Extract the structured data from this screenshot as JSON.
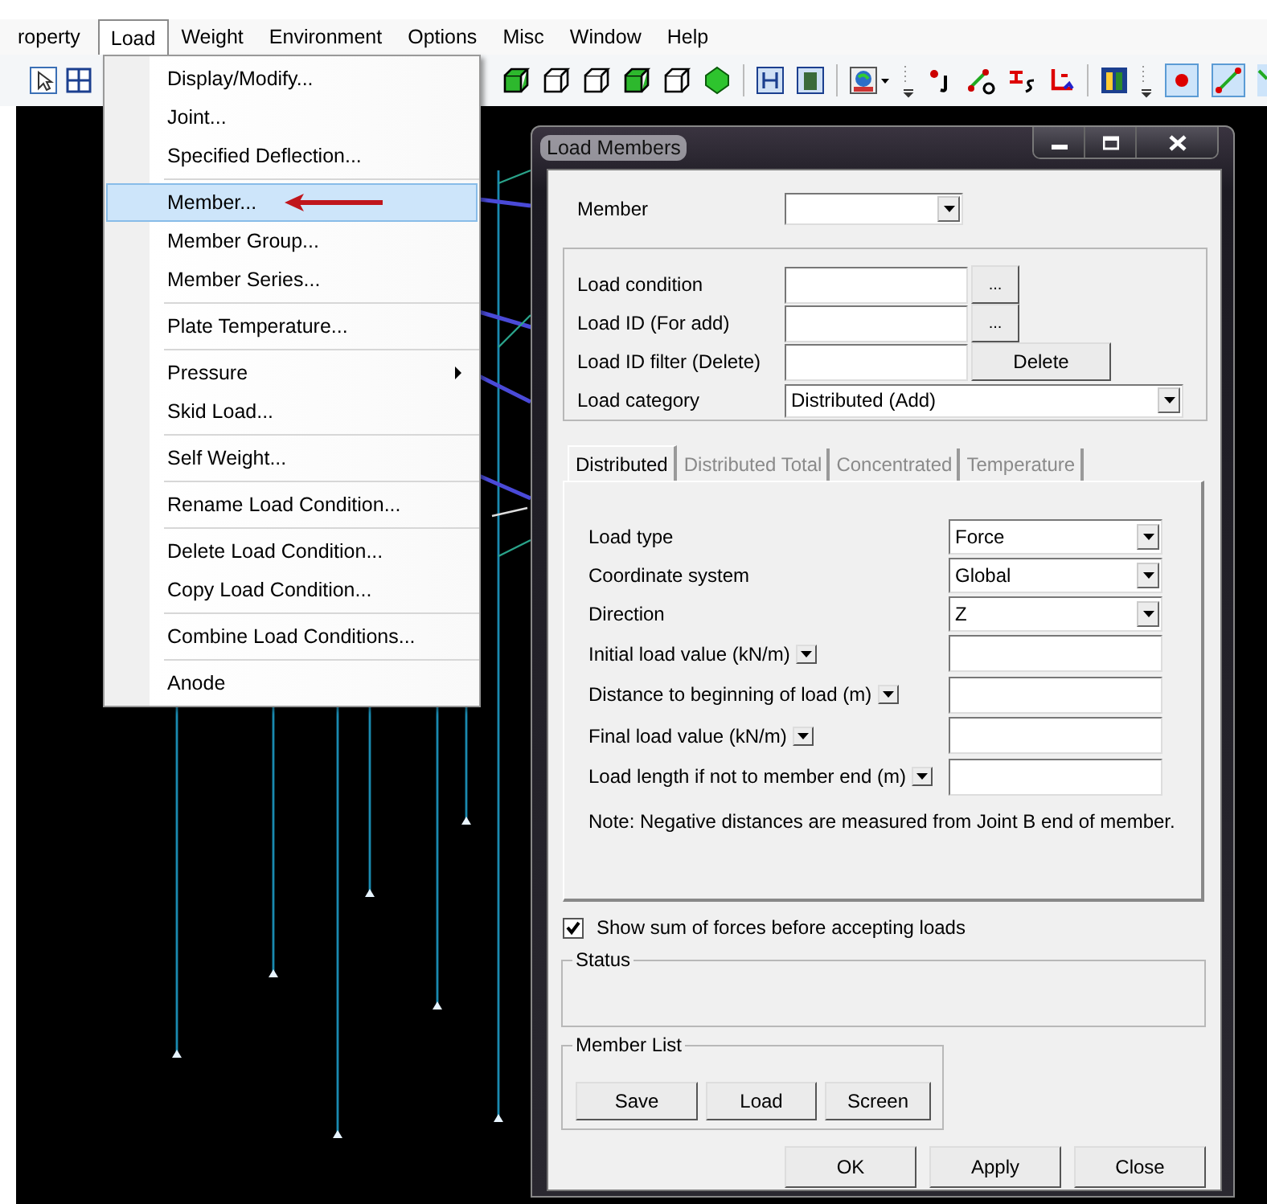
{
  "menubar": {
    "items": [
      {
        "label": "roperty",
        "selected": false
      },
      {
        "label": "Load",
        "selected": true
      },
      {
        "label": "Weight",
        "selected": false
      },
      {
        "label": "Environment",
        "selected": false
      },
      {
        "label": "Options",
        "selected": false
      },
      {
        "label": "Misc",
        "selected": false
      },
      {
        "label": "Window",
        "selected": false
      },
      {
        "label": "Help",
        "selected": false
      }
    ]
  },
  "load_menu": {
    "groups": [
      {
        "items": [
          {
            "label": "Display/Modify...",
            "selected": false
          },
          {
            "label": "Joint...",
            "selected": false
          },
          {
            "label": "Specified Deflection...",
            "selected": false
          }
        ]
      },
      {
        "items": [
          {
            "label": "Member...",
            "selected": true,
            "marked": true
          },
          {
            "label": "Member Group...",
            "selected": false
          },
          {
            "label": "Member Series...",
            "selected": false
          }
        ]
      },
      {
        "items": [
          {
            "label": "Plate Temperature...",
            "selected": false
          }
        ]
      },
      {
        "items": [
          {
            "label": "Pressure",
            "selected": false,
            "submenu": true
          },
          {
            "label": "Skid Load...",
            "selected": false
          }
        ]
      },
      {
        "items": [
          {
            "label": "Self Weight...",
            "selected": false
          }
        ]
      },
      {
        "items": [
          {
            "label": "Rename Load Condition...",
            "selected": false
          }
        ]
      },
      {
        "items": [
          {
            "label": "Delete Load Condition...",
            "selected": false
          },
          {
            "label": "Copy Load Condition...",
            "selected": false
          }
        ]
      },
      {
        "items": [
          {
            "label": "Combine Load Conditions...",
            "selected": false
          }
        ]
      },
      {
        "items": [
          {
            "label": "Anode",
            "selected": false
          }
        ]
      }
    ]
  },
  "dialog": {
    "title": "Load Members",
    "member": {
      "label": "Member"
    },
    "load_group": {
      "rows": [
        {
          "kind": "browse",
          "label": "Load condition",
          "button": "..."
        },
        {
          "kind": "browse",
          "label": "Load ID (For add)",
          "button": "..."
        },
        {
          "kind": "action",
          "label": "Load ID filter (Delete)",
          "button": "Delete"
        },
        {
          "kind": "combo",
          "label": "Load category",
          "value": "Distributed (Add)"
        }
      ]
    },
    "tabs": [
      {
        "label": "Distributed",
        "selected": true
      },
      {
        "label": "Distributed Total",
        "selected": false
      },
      {
        "label": "Concentrated",
        "selected": false
      },
      {
        "label": "Temperature",
        "selected": false
      }
    ],
    "tab_panel": {
      "rows": [
        {
          "kind": "combo",
          "label": "Load type",
          "value": "Force"
        },
        {
          "kind": "combo",
          "label": "Coordinate system",
          "value": "Global"
        },
        {
          "kind": "combo",
          "label": "Direction",
          "value": "Z"
        },
        {
          "kind": "unit_field",
          "label": "Initial load value (kN/m)"
        },
        {
          "kind": "unit_field",
          "label": "Distance to beginning of load (m)"
        },
        {
          "kind": "unit_field",
          "label": "Final load value (kN/m)"
        },
        {
          "kind": "unit_field",
          "label": "Load length if not to member end (m)"
        }
      ],
      "note": "Note: Negative distances are measured from Joint B end of member."
    },
    "show_sum": {
      "label": "Show sum of forces before accepting loads",
      "checked": true
    },
    "status": {
      "label": "Status"
    },
    "member_list": {
      "label": "Member List",
      "buttons": [
        "Save",
        "Load",
        "Screen"
      ]
    },
    "buttons": [
      "OK",
      "Apply",
      "Close"
    ]
  }
}
